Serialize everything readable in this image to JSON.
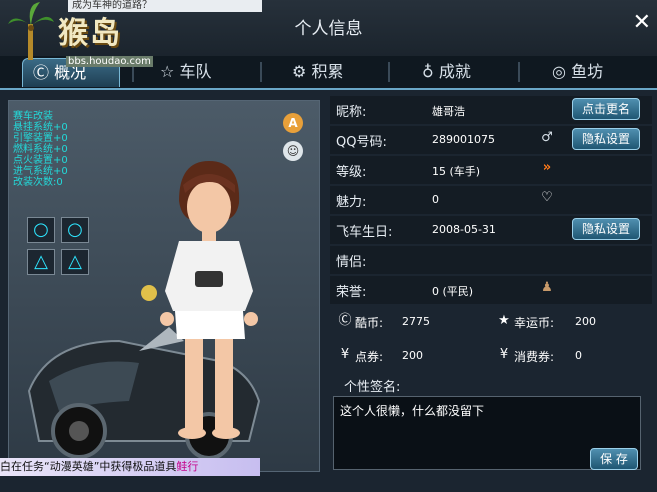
{
  "window": {
    "title": "个人信息",
    "strip_text": "成为车神的道路？",
    "brand": "猴岛",
    "url": "bbs.houdao.com"
  },
  "tabs": [
    {
      "label": "概况",
      "icon": "circle-c-icon"
    },
    {
      "label": "车队",
      "icon": "star-icon"
    },
    {
      "label": "积累",
      "icon": "gear-icon"
    },
    {
      "label": "成就",
      "icon": "medal-icon"
    },
    {
      "label": "鱼坊",
      "icon": "fish-icon"
    }
  ],
  "kit": {
    "title": "赛车改装",
    "lines": [
      "悬挂系统+0",
      "引擎装置+0",
      "燃料系统+0",
      "点火装置+0",
      "进气系统+0",
      "改装次数:0"
    ]
  },
  "slots": [
    "○",
    "○",
    "△",
    "△"
  ],
  "profile": {
    "nickname": {
      "label": "昵称:",
      "value": "雄哥浩"
    },
    "qq": {
      "label": "QQ号码:",
      "value": "289001075"
    },
    "level": {
      "label": "等级:",
      "value": "15 (车手)"
    },
    "charm": {
      "label": "魅力:",
      "value": "0"
    },
    "birthday": {
      "label": "飞车生日:",
      "value": "2008-05-31"
    },
    "partner": {
      "label": "情侣:",
      "value": ""
    },
    "honor": {
      "label": "荣誉:",
      "value": "0 (平民)"
    }
  },
  "buttons": {
    "rename": "点击更名",
    "privacy1": "隐私设置",
    "privacy2": "隐私设置",
    "save": "保 存"
  },
  "currency": {
    "coolcoin": {
      "label": "酷币:",
      "value": "2775"
    },
    "luckycoin": {
      "label": "幸运币:",
      "value": "200"
    },
    "points": {
      "label": "点券:",
      "value": "200"
    },
    "consume": {
      "label": "消费券:",
      "value": "0"
    }
  },
  "signature": {
    "label": "个性签名:",
    "text": "这个人很懒，什么都没留下"
  },
  "ticker": {
    "text": "白在任务“动漫英雄”中获得极品道具",
    "highlight": "鲑行"
  },
  "colors": {
    "accent": "#6aa7c7",
    "kit_text": "#23d9d9",
    "button": "#2f7395"
  }
}
